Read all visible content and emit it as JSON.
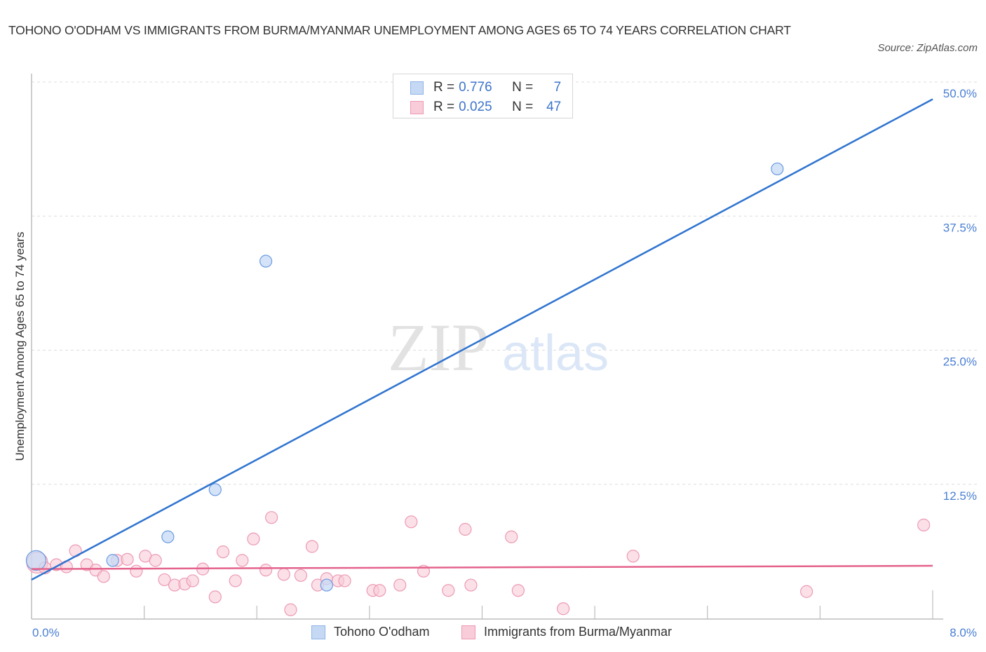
{
  "header": {
    "title": "TOHONO O'ODHAM VS IMMIGRANTS FROM BURMA/MYANMAR UNEMPLOYMENT AMONG AGES 65 TO 74 YEARS CORRELATION CHART",
    "source": "Source: ZipAtlas.com"
  },
  "legend_top": {
    "rows": [
      {
        "r_label": "R =",
        "r_value": "0.776",
        "n_label": "N =",
        "n_value": "7"
      },
      {
        "r_label": "R =",
        "r_value": "0.025",
        "n_label": "N =",
        "n_value": "47"
      }
    ]
  },
  "watermark": {
    "zip": "ZIP",
    "atlas": "atlas"
  },
  "colors": {
    "blue": "#2f74d0",
    "blue_fill": "#c5d9f5",
    "blue_stroke": "#6a9ae0",
    "pink": "#e4628c",
    "pink_fill": "#f9ccd9",
    "pink_stroke": "#ec9ab4",
    "tick_label": "#4a7fd4"
  },
  "chart_data": {
    "type": "scatter",
    "title": "TOHONO O'ODHAM VS IMMIGRANTS FROM BURMA/MYANMAR UNEMPLOYMENT AMONG AGES 65 TO 74 YEARS CORRELATION CHART",
    "xlabel": "",
    "ylabel": "Unemployment Among Ages 65 to 74 years",
    "xlim": [
      0,
      8
    ],
    "ylim": [
      0,
      50
    ],
    "x_tick_labels": [
      "0.0%",
      "8.0%"
    ],
    "y_ticks": [
      12.5,
      25.0,
      37.5,
      50.0
    ],
    "y_tick_labels": [
      "12.5%",
      "25.0%",
      "37.5%",
      "50.0%"
    ],
    "grid": "horizontal dashed",
    "legend": "bottom-center",
    "series": [
      {
        "name": "Tohono O'odham",
        "R": 0.776,
        "N": 7,
        "points": [
          {
            "x": 0.04,
            "y": 5.4,
            "large": true
          },
          {
            "x": 0.72,
            "y": 5.4
          },
          {
            "x": 1.21,
            "y": 7.6
          },
          {
            "x": 1.63,
            "y": 12.0
          },
          {
            "x": 2.08,
            "y": 33.3
          },
          {
            "x": 2.62,
            "y": 3.1
          },
          {
            "x": 6.62,
            "y": 41.9
          }
        ],
        "trend": {
          "x0": 0,
          "y0": 3.6,
          "x1": 8,
          "y1": 48.4
        }
      },
      {
        "name": "Immigrants from Burma/Myanmar",
        "R": 0.025,
        "N": 47,
        "points": [
          {
            "x": 0.05,
            "y": 5.2,
            "large": true
          },
          {
            "x": 0.12,
            "y": 4.7
          },
          {
            "x": 0.22,
            "y": 5.0
          },
          {
            "x": 0.31,
            "y": 4.8
          },
          {
            "x": 0.39,
            "y": 6.3
          },
          {
            "x": 0.49,
            "y": 5.0
          },
          {
            "x": 0.57,
            "y": 4.5
          },
          {
            "x": 0.64,
            "y": 3.9
          },
          {
            "x": 0.76,
            "y": 5.4
          },
          {
            "x": 0.85,
            "y": 5.5
          },
          {
            "x": 0.93,
            "y": 4.4
          },
          {
            "x": 1.01,
            "y": 5.8
          },
          {
            "x": 1.1,
            "y": 5.4
          },
          {
            "x": 1.18,
            "y": 3.6
          },
          {
            "x": 1.27,
            "y": 3.1
          },
          {
            "x": 1.36,
            "y": 3.2
          },
          {
            "x": 1.43,
            "y": 3.5
          },
          {
            "x": 1.52,
            "y": 4.6
          },
          {
            "x": 1.63,
            "y": 2.0
          },
          {
            "x": 1.7,
            "y": 6.2
          },
          {
            "x": 1.81,
            "y": 3.5
          },
          {
            "x": 1.87,
            "y": 5.4
          },
          {
            "x": 1.97,
            "y": 7.4
          },
          {
            "x": 2.08,
            "y": 4.5
          },
          {
            "x": 2.13,
            "y": 9.4
          },
          {
            "x": 2.24,
            "y": 4.1
          },
          {
            "x": 2.3,
            "y": 0.8
          },
          {
            "x": 2.39,
            "y": 4.0
          },
          {
            "x": 2.49,
            "y": 6.7
          },
          {
            "x": 2.54,
            "y": 3.1
          },
          {
            "x": 2.62,
            "y": 3.7
          },
          {
            "x": 2.72,
            "y": 3.5
          },
          {
            "x": 2.78,
            "y": 3.5
          },
          {
            "x": 3.03,
            "y": 2.6
          },
          {
            "x": 3.09,
            "y": 2.6
          },
          {
            "x": 3.27,
            "y": 3.1
          },
          {
            "x": 3.37,
            "y": 9.0
          },
          {
            "x": 3.48,
            "y": 4.4
          },
          {
            "x": 3.7,
            "y": 2.6
          },
          {
            "x": 3.85,
            "y": 8.3
          },
          {
            "x": 3.9,
            "y": 3.1
          },
          {
            "x": 4.26,
            "y": 7.6
          },
          {
            "x": 4.32,
            "y": 2.6
          },
          {
            "x": 4.72,
            "y": 0.9
          },
          {
            "x": 5.34,
            "y": 5.8
          },
          {
            "x": 6.88,
            "y": 2.5
          },
          {
            "x": 7.92,
            "y": 8.7
          }
        ],
        "trend": {
          "x0": 0,
          "y0": 4.6,
          "x1": 8,
          "y1": 4.9
        }
      }
    ]
  },
  "bottom_legend": {
    "items": [
      {
        "label": "Tohono O'odham"
      },
      {
        "label": "Immigrants from Burma/Myanmar"
      }
    ]
  }
}
